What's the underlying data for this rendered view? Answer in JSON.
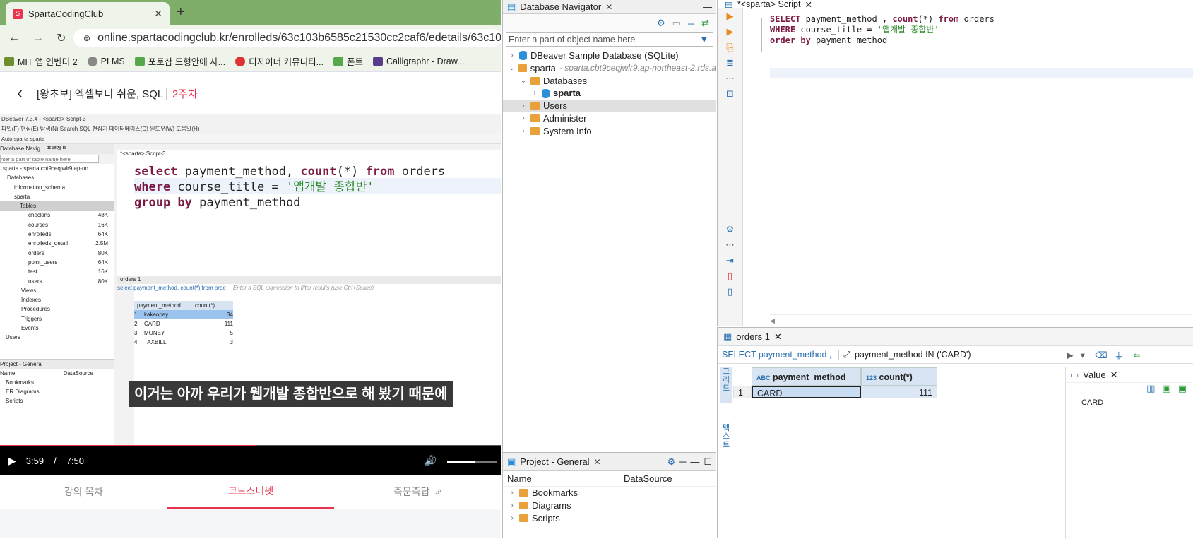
{
  "browser": {
    "tab_title": "SpartaCodingClub",
    "url": "online.spartacodingclub.kr/enrolleds/63c103b6585c21530cc2caf6/edetails/63c103...",
    "bookmarks": [
      "MIT 앱 인벤터 2",
      "PLMS",
      "포토샵 도형안에 사...",
      "디자이너 커뮤니티...",
      "폰트",
      "Calligraphr - Draw..."
    ]
  },
  "course": {
    "title": "[왕초보] 엑셀보다 쉬운, SQL",
    "week": "2주차"
  },
  "video": {
    "dbeaver_title": "DBeaver 7.3.4 - <sparta> Script-3",
    "menu": "파일(F)  편집(E)  탐색(N)  Search  SQL 편집기  데이터베이스(D)  윈도우(W)  도움말(H)",
    "toolbar": "Auto     sparta     sparta",
    "left_tab": "Database Navig...  프로젝트",
    "filter": "nter a part of table name here",
    "tree": [
      {
        "label": "sparta  - sparta.cbt9ceqjwlr9.ap-no",
        "size": ""
      },
      {
        "label": "Databases",
        "size": ""
      },
      {
        "label": "information_schema",
        "size": ""
      },
      {
        "label": "sparta",
        "size": ""
      },
      {
        "label": "Tables",
        "size": ""
      },
      {
        "label": "checkins",
        "size": "48K"
      },
      {
        "label": "courses",
        "size": "16K"
      },
      {
        "label": "enrolleds",
        "size": "64K"
      },
      {
        "label": "enrolleds_detail",
        "size": "2.5M"
      },
      {
        "label": "orders",
        "size": "80K"
      },
      {
        "label": "point_users",
        "size": "64K"
      },
      {
        "label": "test",
        "size": "16K"
      },
      {
        "label": "users",
        "size": "80K"
      },
      {
        "label": "Views",
        "size": ""
      },
      {
        "label": "Indexes",
        "size": ""
      },
      {
        "label": "Procedures",
        "size": ""
      },
      {
        "label": "Triggers",
        "size": ""
      },
      {
        "label": "Events",
        "size": ""
      },
      {
        "label": "Users",
        "size": ""
      }
    ],
    "project_label": "Project - General",
    "project_cols": [
      "Name",
      "DataSource"
    ],
    "project_items": [
      "Bookmarks",
      "ER Diagrams",
      "Scripts"
    ],
    "script_tab": "*<sparta> Script-3",
    "sql_l1a": "select",
    "sql_l1b": " payment_method, ",
    "sql_l1c": "count",
    "sql_l1d": "(*) ",
    "sql_l1e": "from",
    "sql_l1f": " orders",
    "sql_l2a": "where",
    "sql_l2b": " course_title = ",
    "sql_l2c": "'앱개발 종합반'",
    "sql_l3a": "group by",
    "sql_l3b": " payment_method",
    "result_tab": "orders 1",
    "result_query": "select payment_method, count(*) from orde",
    "result_filter": "Enter a SQL expression to filter results (use Ctrl+Space)",
    "cols": [
      "payment_method",
      "count(*)"
    ],
    "rows": [
      {
        "n": "1",
        "m": "kakaopay",
        "c": "34"
      },
      {
        "n": "2",
        "m": "CARD",
        "c": "111"
      },
      {
        "n": "3",
        "m": "MONEY",
        "c": "5"
      },
      {
        "n": "4",
        "m": "TAXBILL",
        "c": "3"
      }
    ],
    "subtitle": "이거는 아까 우리가 웹개발 종합반으로 해 봤기 때문에",
    "time_current": "3:59",
    "time_sep": "/",
    "time_total": "7:50",
    "progress": 0.51,
    "volume": 0.55
  },
  "lower_tabs": [
    "강의 목차",
    "코드스니펫",
    "즉문즉답"
  ],
  "dbeaver": {
    "nav_title": "Database Navigator",
    "nav_filter": "Enter a part of object name here",
    "nav_tree": [
      {
        "label": "DBeaver Sample Database (SQLite)",
        "sub": ""
      },
      {
        "label": "sparta",
        "sub": "- sparta.cbt9ceqjwlr9.ap-northeast-2.rds.a"
      },
      {
        "label": "Databases",
        "sub": ""
      },
      {
        "label": "sparta",
        "sub": ""
      },
      {
        "label": "Users",
        "sub": ""
      },
      {
        "label": "Administer",
        "sub": ""
      },
      {
        "label": "System Info",
        "sub": ""
      }
    ],
    "project_title": "Project - General",
    "project_cols": [
      "Name",
      "DataSource"
    ],
    "project_items": [
      "Bookmarks",
      "Diagrams",
      "Scripts"
    ],
    "editor_tab": "*<sparta> Script",
    "code_l1a": "SELECT",
    "code_l1b": " payment_method , ",
    "code_l1c": "count",
    "code_l1d": "(*) ",
    "code_l1e": "from",
    "code_l1f": " orders",
    "code_l2a": "WHERE",
    "code_l2b": " course_title = ",
    "code_l2c": "'앱개발 종합반'",
    "code_l3a": "order by",
    "code_l3b": " payment_method",
    "result_tab": "orders 1",
    "result_query": "SELECT payment_method ,",
    "result_filter": "payment_method IN ('CARD')",
    "cols": [
      "payment_method",
      "count(*)"
    ],
    "col_types": [
      "ABC",
      "123"
    ],
    "grid_side": "그리드",
    "text_side": "텍스트",
    "rows": [
      {
        "n": "1",
        "m": "CARD",
        "c": "111"
      }
    ],
    "value_tab": "Value",
    "value_content": "CARD"
  }
}
